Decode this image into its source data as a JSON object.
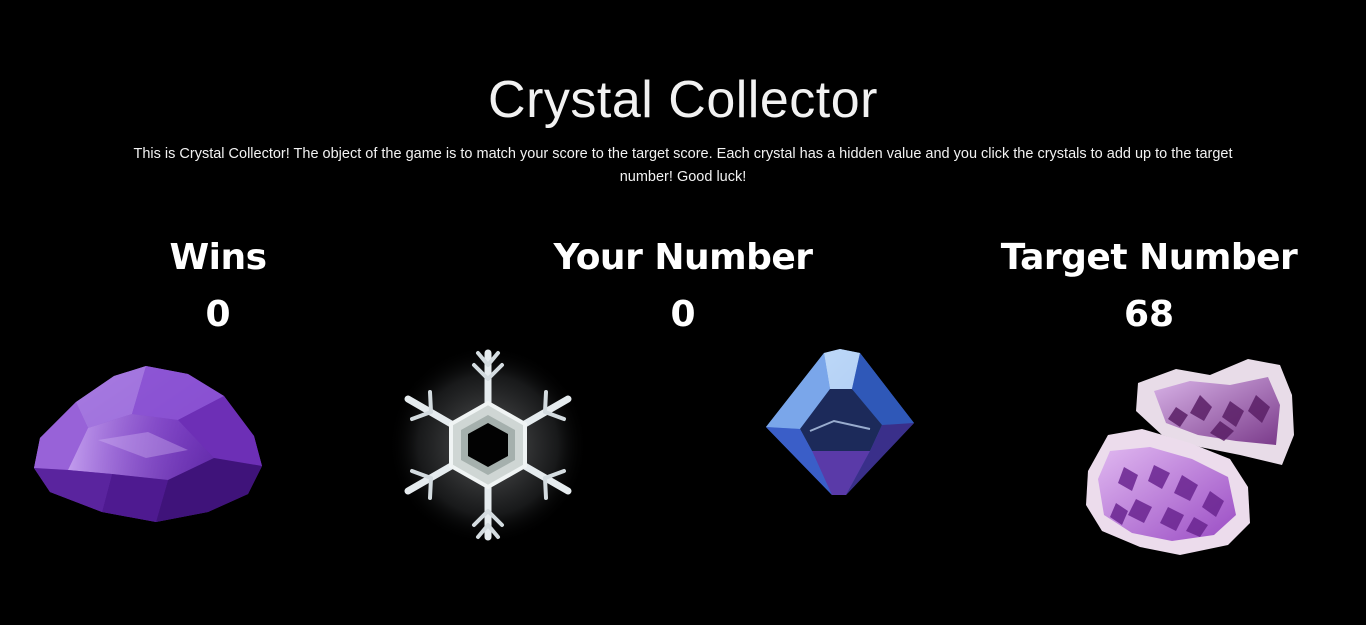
{
  "header": {
    "title": "Crystal Collector",
    "intro": "This is Crystal Collector! The object of the game is to match your score to the target score. Each crystal has a hidden value and you click the crystals to add up to the target number! Good luck!"
  },
  "scoreboard": {
    "wins_label": "Wins",
    "wins_value": "0",
    "your_number_label": "Your Number",
    "your_number_value": "0",
    "target_label": "Target Number",
    "target_value": "68"
  },
  "crystals": [
    {
      "icon": "purple-amethyst-crystal-icon",
      "color": "#7b3fbf"
    },
    {
      "icon": "snowflake-crystal-icon",
      "color": "#d8dde0"
    },
    {
      "icon": "blue-diamond-crystal-icon",
      "color": "#3a6fd8"
    },
    {
      "icon": "amethyst-geode-cluster-icon",
      "color": "#a765c8"
    }
  ],
  "colors": {
    "background": "#000000",
    "text": "#ffffff"
  }
}
